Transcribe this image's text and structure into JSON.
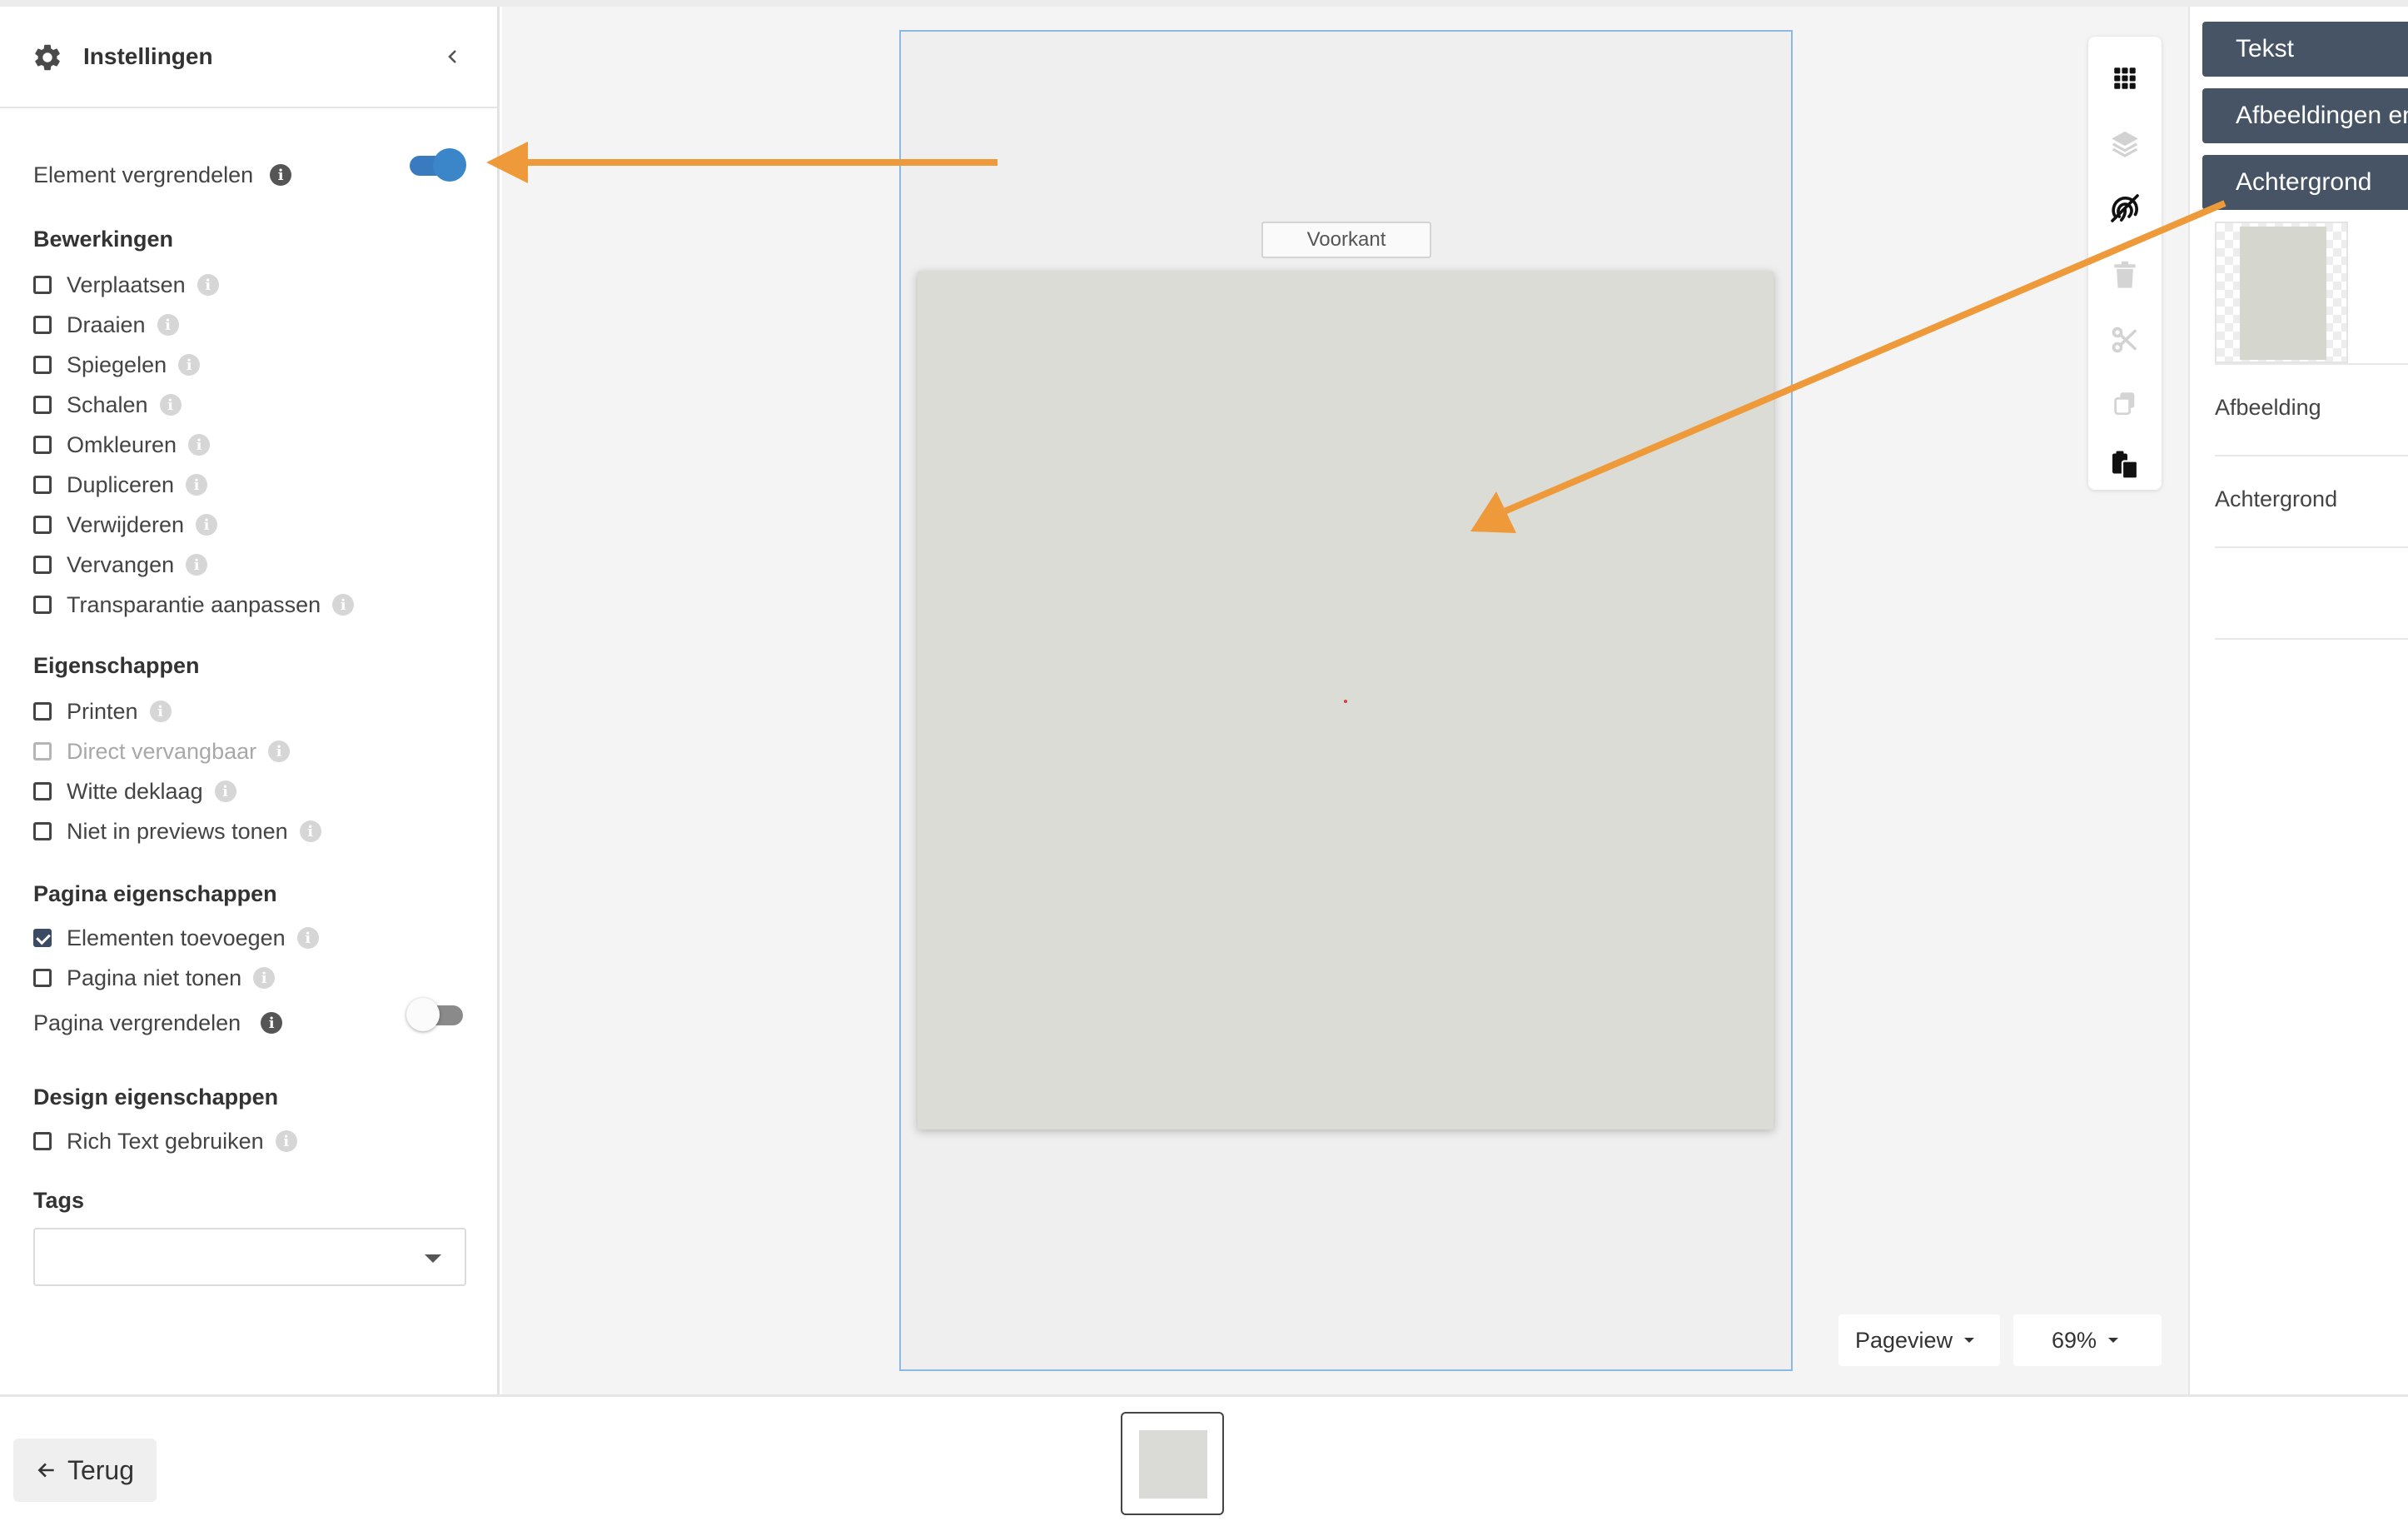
{
  "settings_panel": {
    "title": "Instellingen",
    "icons": {
      "settings": "gear-icon",
      "collapse": "chevron-left-icon"
    },
    "element_lock": {
      "label": "Element vergrendelen",
      "on": true
    },
    "bewerkingen": {
      "heading": "Bewerkingen",
      "items": [
        {
          "label": "Verplaatsen",
          "checked": false
        },
        {
          "label": "Draaien",
          "checked": false
        },
        {
          "label": "Spiegelen",
          "checked": false
        },
        {
          "label": "Schalen",
          "checked": false
        },
        {
          "label": "Omkleuren",
          "checked": false
        },
        {
          "label": "Dupliceren",
          "checked": false
        },
        {
          "label": "Verwijderen",
          "checked": false
        },
        {
          "label": "Vervangen",
          "checked": false
        },
        {
          "label": "Transparantie aanpassen",
          "checked": false
        }
      ]
    },
    "eigenschappen": {
      "heading": "Eigenschappen",
      "items": [
        {
          "label": "Printen",
          "checked": false,
          "disabled": false
        },
        {
          "label": "Direct vervangbaar",
          "checked": false,
          "disabled": true
        },
        {
          "label": "Witte deklaag",
          "checked": false,
          "disabled": false
        },
        {
          "label": "Niet in previews tonen",
          "checked": false,
          "disabled": false
        }
      ]
    },
    "pagina_eigenschappen": {
      "heading": "Pagina eigenschappen",
      "items": [
        {
          "label": "Elementen toevoegen",
          "checked": true
        },
        {
          "label": "Pagina niet tonen",
          "checked": false
        }
      ],
      "page_lock": {
        "label": "Pagina vergrendelen",
        "on": false
      }
    },
    "design_eigenschappen": {
      "heading": "Design eigenschappen",
      "items": [
        {
          "label": "Rich Text gebruiken",
          "checked": false
        }
      ]
    },
    "tags": {
      "heading": "Tags",
      "value": ""
    }
  },
  "canvas": {
    "side_label": "Voorkant",
    "pageview_label": "Pageview",
    "zoom_label": "69%"
  },
  "toolbar": {
    "icons": [
      "grid-icon",
      "layers-icon",
      "fingerprint-icon",
      "trash-icon",
      "scissors-icon",
      "copy-icon",
      "paste-icon"
    ]
  },
  "right_panel": {
    "tabs": [
      "Tekst",
      "Afbeeldingen en",
      "Achtergrond"
    ],
    "items": [
      "Afbeelding",
      "Achtergrond"
    ]
  },
  "bottom": {
    "back_label": "Terug"
  },
  "colors": {
    "accent": "#3a86c8",
    "tab_bg": "#465466",
    "annotation_arrow": "#ee9a3a",
    "frame_border": "#8cb8e6"
  }
}
